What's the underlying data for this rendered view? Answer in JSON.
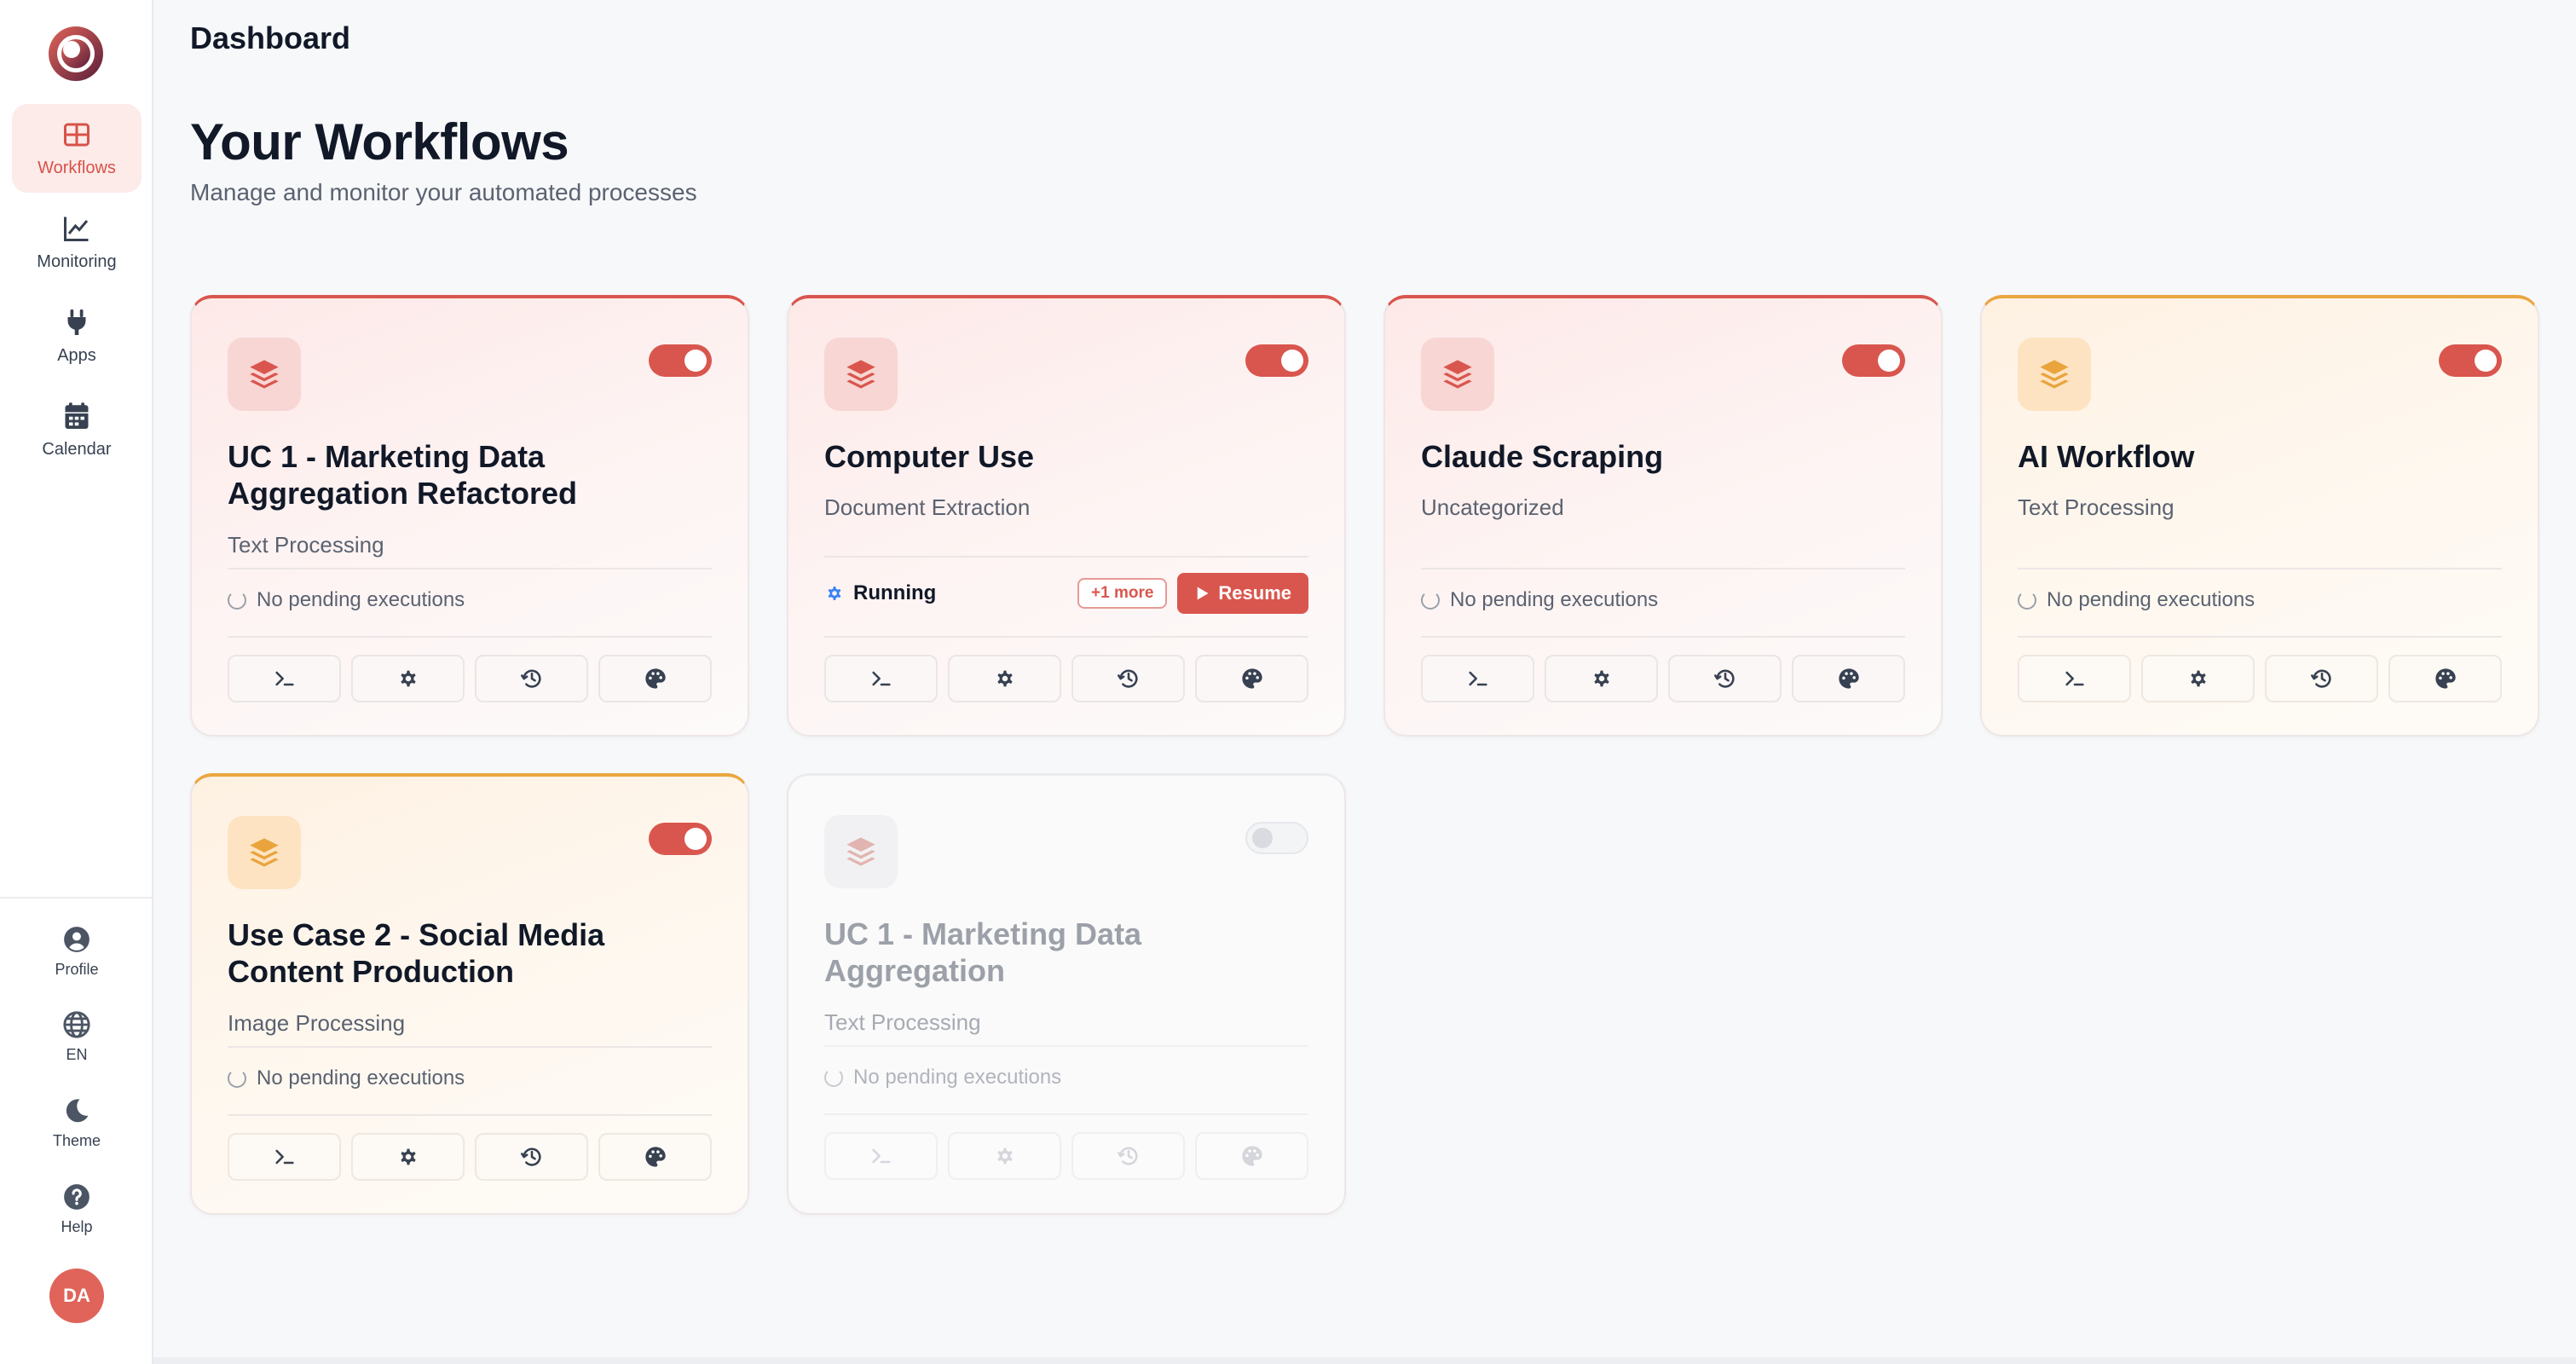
{
  "header": {
    "title": "Dashboard"
  },
  "page": {
    "title": "Your Workflows",
    "subtitle": "Manage and monitor your automated processes"
  },
  "sidebar": {
    "items": [
      {
        "label": "Workflows",
        "icon": "grid-icon",
        "active": true
      },
      {
        "label": "Monitoring",
        "icon": "chart-line-icon",
        "active": false
      },
      {
        "label": "Apps",
        "icon": "plug-icon",
        "active": false
      },
      {
        "label": "Calendar",
        "icon": "calendar-icon",
        "active": false
      }
    ],
    "utilities": [
      {
        "label": "Profile",
        "icon": "user-circle-icon"
      },
      {
        "label": "EN",
        "icon": "globe-icon"
      },
      {
        "label": "Theme",
        "icon": "moon-icon"
      },
      {
        "label": "Help",
        "icon": "help-circle-icon"
      }
    ],
    "avatar": "DA"
  },
  "colors": {
    "accent": "#d9564e",
    "orange": "#eaa640",
    "running_icon": "#3b82f6"
  },
  "workflows": [
    {
      "title": "UC 1 - Marketing Data Aggregation Refactored",
      "category": "Text Processing",
      "status": "No pending executions",
      "enabled": true,
      "color": "red"
    },
    {
      "title": "Computer Use",
      "category": "Document Extraction",
      "status": "Running",
      "more": "+1 more",
      "resume": "Resume",
      "enabled": true,
      "color": "red"
    },
    {
      "title": "Claude Scraping",
      "category": "Uncategorized",
      "status": "No pending executions",
      "enabled": true,
      "color": "red"
    },
    {
      "title": "AI Workflow",
      "category": "Text Processing",
      "status": "No pending executions",
      "enabled": true,
      "color": "orange"
    },
    {
      "title": "Use Case 2 - Social Media Content Production",
      "category": "Image Processing",
      "status": "No pending executions",
      "enabled": true,
      "color": "orange"
    },
    {
      "title": "UC 1 - Marketing Data Aggregation",
      "category": "Text Processing",
      "status": "No pending executions",
      "enabled": false,
      "color": "gray"
    }
  ],
  "card_actions": [
    "terminal-icon",
    "gear-icon",
    "history-icon",
    "palette-icon"
  ]
}
